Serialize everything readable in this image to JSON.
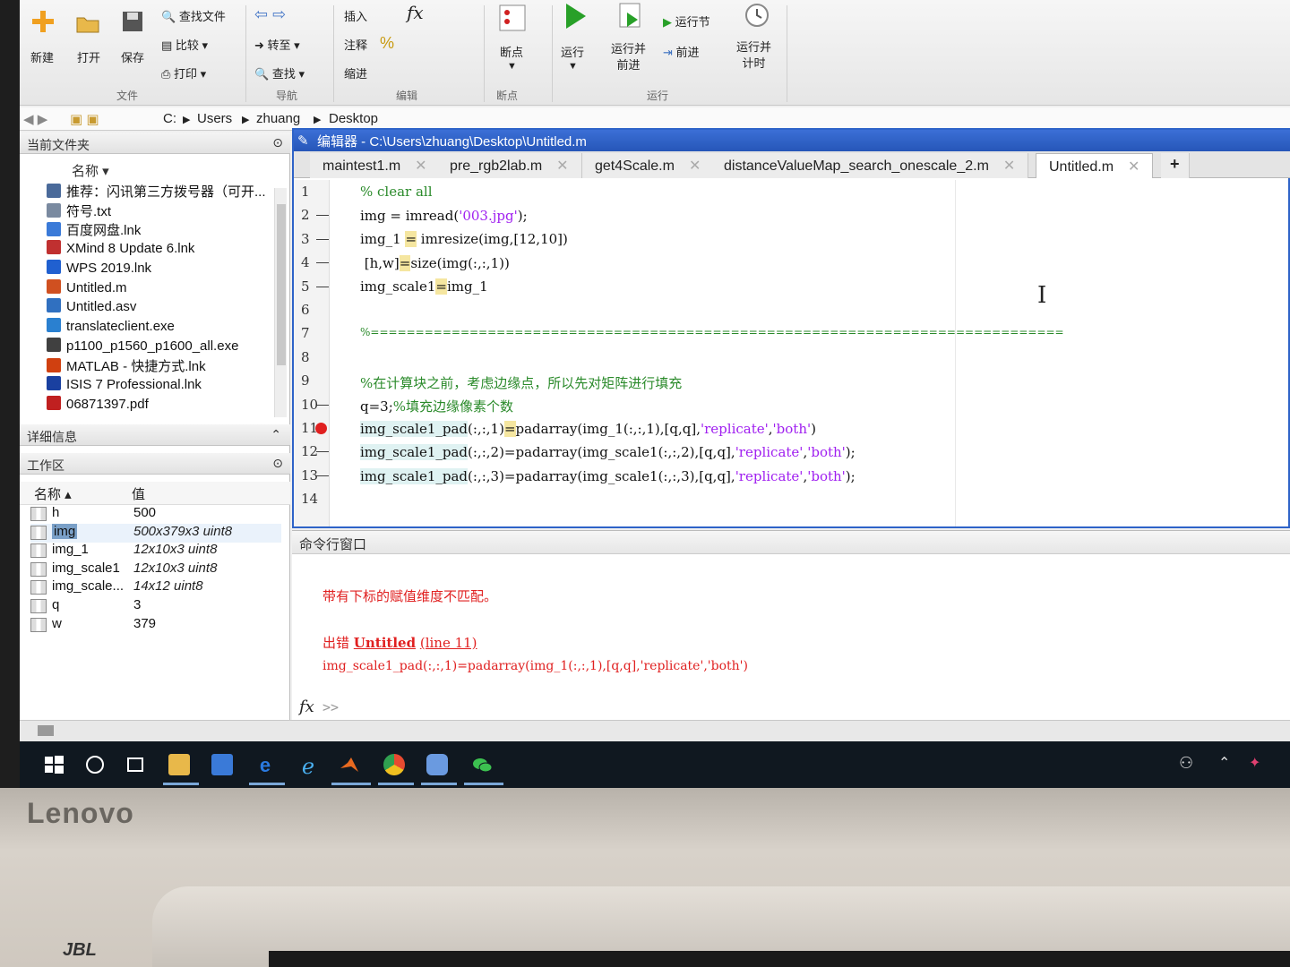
{
  "ribbon": {
    "new": "新建",
    "open": "打开",
    "save": "保存",
    "find_files": "查找文件",
    "compare": "比较",
    "print": "打印",
    "goto": "转至",
    "find": "查找",
    "insert": "插入",
    "fx": "fx",
    "comment": "注释",
    "percent": "%",
    "indent": "缩进",
    "breakpoint": "断点",
    "run": "运行",
    "run_advance_1": "运行并",
    "run_advance_2": "前进",
    "run_section": "运行节",
    "advance": "前进",
    "run_time_1": "运行并",
    "run_time_2": "计时",
    "groups": {
      "file": "文件",
      "navigate": "导航",
      "edit": "编辑",
      "breakpoints": "断点",
      "run": "运行"
    }
  },
  "address": {
    "drive": "C:",
    "p1": "Users",
    "p2": "zhuang",
    "p3": "Desktop"
  },
  "current_folder": {
    "title": "当前文件夹",
    "col_name": "名称",
    "files": [
      {
        "name": "推荐：闪讯第三方拨号器（可开...",
        "color": "#4a6a9a"
      },
      {
        "name": "符号.txt",
        "color": "#7a8aa0"
      },
      {
        "name": "百度网盘.lnk",
        "color": "#3a7ad8"
      },
      {
        "name": "XMind 8 Update 6.lnk",
        "color": "#c03030"
      },
      {
        "name": "WPS 2019.lnk",
        "color": "#2060d0"
      },
      {
        "name": "Untitled.m",
        "color": "#d05020"
      },
      {
        "name": "Untitled.asv",
        "color": "#3070c0"
      },
      {
        "name": "translateclient.exe",
        "color": "#2a80d0"
      },
      {
        "name": "p1100_p1560_p1600_all.exe",
        "color": "#404040"
      },
      {
        "name": "MATLAB - 快捷方式.lnk",
        "color": "#d04010"
      },
      {
        "name": "ISIS 7 Professional.lnk",
        "color": "#1a40a0"
      },
      {
        "name": "06871397.pdf",
        "color": "#c02020"
      }
    ]
  },
  "details": {
    "title": "详细信息"
  },
  "workspace": {
    "title": "工作区",
    "col_name": "名称",
    "col_value": "值",
    "vars": [
      {
        "name": "h",
        "value": "500",
        "italic": false
      },
      {
        "name": "img",
        "value": "500x379x3 uint8",
        "italic": true
      },
      {
        "name": "img_1",
        "value": "12x10x3 uint8",
        "italic": true
      },
      {
        "name": "img_scale1",
        "value": "12x10x3 uint8",
        "italic": true
      },
      {
        "name": "img_scale...",
        "value": "14x12 uint8",
        "italic": true
      },
      {
        "name": "q",
        "value": "3",
        "italic": false
      },
      {
        "name": "w",
        "value": "379",
        "italic": false
      }
    ]
  },
  "editor": {
    "title": "编辑器 - C:\\Users\\zhuang\\Desktop\\Untitled.m",
    "tabs": [
      "maintest1.m",
      "pre_rgb2lab.m",
      "get4Scale.m",
      "distanceValueMap_search_onescale_2.m",
      "Untitled.m"
    ],
    "add_tab": "+",
    "close": "✕"
  },
  "code": {
    "l1": "% clear all",
    "l2a": "img = imread(",
    "l2s": "'003.jpg'",
    "l2b": ");",
    "l3a": "img_1 ",
    "l3m": "=",
    "l3b": " imresize(img,[12,10])",
    "l4a": " [h,w]",
    "l4m": "=",
    "l4b": "size(img(:,:,1))",
    "l5a": "img_scale1",
    "l5m": "=",
    "l5b": "img_1",
    "l7": "%=============================================================================",
    "l9": "%在计算块之前，考虑边缘点，所以先对矩阵进行填充",
    "l10a": "q=3;",
    "l10c": "%填充边缘像素个数",
    "l11a": "img_scale1_pad",
    "l11b": "(:,:,1)",
    "l11m": "=",
    "l11c": "padarray(img_1(:,:,1),[q,q],",
    "l11s1": "'replicate'",
    "l11d": ",",
    "l11s2": "'both'",
    "l11e": ")",
    "l12a": "img_scale1_pad",
    "l12b": "(:,:,2)=padarray(img_scale1(:,:,2),[q,q],",
    "l12s1": "'replicate'",
    "l12d": ",",
    "l12s2": "'both'",
    "l12e": ");",
    "l13a": "img_scale1_pad",
    "l13b": "(:,:,3)=padarray(img_scale1(:,:,3),[q,q],",
    "l13s1": "'replicate'",
    "l13d": ",",
    "l13s2": "'both'",
    "l13e": ");"
  },
  "command": {
    "title": "命令行窗口",
    "err1": "带有下标的赋值维度不匹配。",
    "err2_pre": "出错 ",
    "err2_file": "Untitled",
    "err2_line": "(line 11)",
    "err3": "img_scale1_pad(:,:,1)=padarray(img_1(:,:,1),[q,q],'replicate','both')",
    "prompt_fx": "fx",
    "prompt": ">>"
  }
}
